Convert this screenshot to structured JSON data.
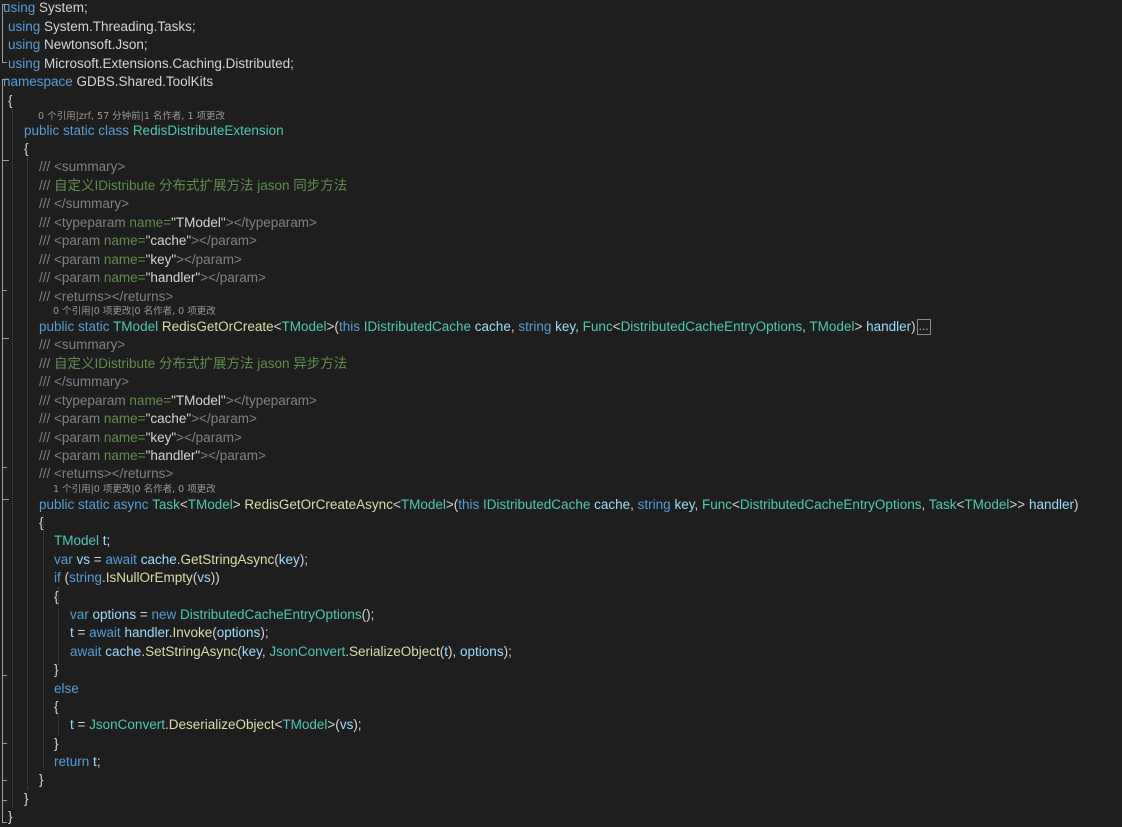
{
  "code_lines": [
    [
      {
        "c": "kw",
        "t": "using"
      },
      {
        "c": "tx",
        "t": " System;"
      }
    ],
    [
      {
        "c": "kw",
        "t": "using"
      },
      {
        "c": "tx",
        "t": " System.Threading.Tasks;"
      }
    ],
    [
      {
        "c": "kw",
        "t": "using"
      },
      {
        "c": "tx",
        "t": " Newtonsoft.Json;"
      }
    ],
    [
      {
        "c": "kw",
        "t": "using"
      },
      {
        "c": "tx",
        "t": " Microsoft.Extensions.Caching.Distributed;"
      }
    ],
    [
      {
        "c": "kw",
        "t": "namespace"
      },
      {
        "c": "tx",
        "t": " GDBS.Shared.ToolKits"
      }
    ],
    [
      {
        "c": "tx",
        "t": "{"
      }
    ],
    [
      {
        "c": "kw",
        "t": "public static class"
      },
      {
        "c": "tx",
        "t": " "
      },
      {
        "c": "ty",
        "t": "RedisDistributeExtension"
      }
    ],
    [
      {
        "c": "tx",
        "t": "{"
      }
    ],
    [
      {
        "c": "cx",
        "t": "/// <summary>"
      }
    ],
    [
      {
        "c": "cx",
        "t": "/// "
      },
      {
        "c": "cg",
        "t": "自定义IDistribute 分布式扩展方法 jason 同步方法"
      }
    ],
    [
      {
        "c": "cx",
        "t": "/// </summary>"
      }
    ],
    [
      {
        "c": "cx",
        "t": "/// <typeparam "
      },
      {
        "c": "cg",
        "t": "name="
      },
      {
        "c": "st",
        "t": "\"TModel\""
      },
      {
        "c": "cx",
        "t": "></typeparam>"
      }
    ],
    [
      {
        "c": "cx",
        "t": "/// <param "
      },
      {
        "c": "cg",
        "t": "name="
      },
      {
        "c": "st",
        "t": "\"cache\""
      },
      {
        "c": "cx",
        "t": "></param>"
      }
    ],
    [
      {
        "c": "cx",
        "t": "/// <param "
      },
      {
        "c": "cg",
        "t": "name="
      },
      {
        "c": "st",
        "t": "\"key\""
      },
      {
        "c": "cx",
        "t": "></param>"
      }
    ],
    [
      {
        "c": "cx",
        "t": "/// <param "
      },
      {
        "c": "cg",
        "t": "name="
      },
      {
        "c": "st",
        "t": "\"handler\""
      },
      {
        "c": "cx",
        "t": "></param>"
      }
    ],
    [
      {
        "c": "cx",
        "t": "/// <returns></returns>"
      }
    ],
    [
      {
        "c": "kw",
        "t": "public static"
      },
      {
        "c": "tx",
        "t": " "
      },
      {
        "c": "ty",
        "t": "TModel"
      },
      {
        "c": "tx",
        "t": " "
      },
      {
        "c": "mt",
        "t": "RedisGetOrCreate"
      },
      {
        "c": "tx",
        "t": "<"
      },
      {
        "c": "ty",
        "t": "TModel"
      },
      {
        "c": "tx",
        "t": ">("
      },
      {
        "c": "kw",
        "t": "this"
      },
      {
        "c": "tx",
        "t": " "
      },
      {
        "c": "ty",
        "t": "IDistributedCache"
      },
      {
        "c": "tx",
        "t": " "
      },
      {
        "c": "pm",
        "t": "cache"
      },
      {
        "c": "tx",
        "t": ", "
      },
      {
        "c": "kw",
        "t": "string"
      },
      {
        "c": "tx",
        "t": " "
      },
      {
        "c": "pm",
        "t": "key"
      },
      {
        "c": "tx",
        "t": ", "
      },
      {
        "c": "ty",
        "t": "Func"
      },
      {
        "c": "tx",
        "t": "<"
      },
      {
        "c": "ty",
        "t": "DistributedCacheEntryOptions"
      },
      {
        "c": "tx",
        "t": ", "
      },
      {
        "c": "ty",
        "t": "TModel"
      },
      {
        "c": "tx",
        "t": "> "
      },
      {
        "c": "pm",
        "t": "handler"
      },
      {
        "c": "tx",
        "t": ")"
      },
      {
        "c": "coll",
        "t": "..."
      }
    ],
    [
      {
        "c": "cx",
        "t": "/// <summary>"
      }
    ],
    [
      {
        "c": "cx",
        "t": "/// "
      },
      {
        "c": "cg",
        "t": "自定义IDistribute 分布式扩展方法 jason 异步方法"
      }
    ],
    [
      {
        "c": "cx",
        "t": "/// </summary>"
      }
    ],
    [
      {
        "c": "cx",
        "t": "/// <typeparam "
      },
      {
        "c": "cg",
        "t": "name="
      },
      {
        "c": "st",
        "t": "\"TModel\""
      },
      {
        "c": "cx",
        "t": "></typeparam>"
      }
    ],
    [
      {
        "c": "cx",
        "t": "/// <param "
      },
      {
        "c": "cg",
        "t": "name="
      },
      {
        "c": "st",
        "t": "\"cache\""
      },
      {
        "c": "cx",
        "t": "></param>"
      }
    ],
    [
      {
        "c": "cx",
        "t": "/// <param "
      },
      {
        "c": "cg",
        "t": "name="
      },
      {
        "c": "st",
        "t": "\"key\""
      },
      {
        "c": "cx",
        "t": "></param>"
      }
    ],
    [
      {
        "c": "cx",
        "t": "/// <param "
      },
      {
        "c": "cg",
        "t": "name="
      },
      {
        "c": "st",
        "t": "\"handler\""
      },
      {
        "c": "cx",
        "t": "></param>"
      }
    ],
    [
      {
        "c": "cx",
        "t": "/// <returns></returns>"
      }
    ],
    [
      {
        "c": "kw",
        "t": "public static async"
      },
      {
        "c": "tx",
        "t": " "
      },
      {
        "c": "ty",
        "t": "Task"
      },
      {
        "c": "tx",
        "t": "<"
      },
      {
        "c": "ty",
        "t": "TModel"
      },
      {
        "c": "tx",
        "t": "> "
      },
      {
        "c": "mt",
        "t": "RedisGetOrCreateAsync"
      },
      {
        "c": "tx",
        "t": "<"
      },
      {
        "c": "ty",
        "t": "TModel"
      },
      {
        "c": "tx",
        "t": ">("
      },
      {
        "c": "kw",
        "t": "this"
      },
      {
        "c": "tx",
        "t": " "
      },
      {
        "c": "ty",
        "t": "IDistributedCache"
      },
      {
        "c": "tx",
        "t": " "
      },
      {
        "c": "pm",
        "t": "cache"
      },
      {
        "c": "tx",
        "t": ", "
      },
      {
        "c": "kw",
        "t": "string"
      },
      {
        "c": "tx",
        "t": " "
      },
      {
        "c": "pm",
        "t": "key"
      },
      {
        "c": "tx",
        "t": ", "
      },
      {
        "c": "ty",
        "t": "Func"
      },
      {
        "c": "tx",
        "t": "<"
      },
      {
        "c": "ty",
        "t": "DistributedCacheEntryOptions"
      },
      {
        "c": "tx",
        "t": ", "
      },
      {
        "c": "ty",
        "t": "Task"
      },
      {
        "c": "tx",
        "t": "<"
      },
      {
        "c": "ty",
        "t": "TModel"
      },
      {
        "c": "tx",
        "t": ">> "
      },
      {
        "c": "pm",
        "t": "handler"
      },
      {
        "c": "tx",
        "t": ")"
      }
    ],
    [
      {
        "c": "tx",
        "t": "{"
      }
    ],
    [
      {
        "c": "ty",
        "t": "TModel"
      },
      {
        "c": "tx",
        "t": " "
      },
      {
        "c": "pm",
        "t": "t"
      },
      {
        "c": "tx",
        "t": ";"
      }
    ],
    [
      {
        "c": "kw",
        "t": "var"
      },
      {
        "c": "tx",
        "t": " "
      },
      {
        "c": "pm",
        "t": "vs"
      },
      {
        "c": "tx",
        "t": " = "
      },
      {
        "c": "kw",
        "t": "await"
      },
      {
        "c": "tx",
        "t": " "
      },
      {
        "c": "pm",
        "t": "cache"
      },
      {
        "c": "tx",
        "t": "."
      },
      {
        "c": "mt",
        "t": "GetStringAsync"
      },
      {
        "c": "tx",
        "t": "("
      },
      {
        "c": "pm",
        "t": "key"
      },
      {
        "c": "tx",
        "t": ");"
      }
    ],
    [
      {
        "c": "kw",
        "t": "if"
      },
      {
        "c": "tx",
        "t": " ("
      },
      {
        "c": "kw",
        "t": "string"
      },
      {
        "c": "tx",
        "t": "."
      },
      {
        "c": "mt",
        "t": "IsNullOrEmpty"
      },
      {
        "c": "tx",
        "t": "("
      },
      {
        "c": "pm",
        "t": "vs"
      },
      {
        "c": "tx",
        "t": "))"
      }
    ],
    [
      {
        "c": "tx",
        "t": "{"
      }
    ],
    [
      {
        "c": "kw",
        "t": "var"
      },
      {
        "c": "tx",
        "t": " "
      },
      {
        "c": "pm",
        "t": "options"
      },
      {
        "c": "tx",
        "t": " = "
      },
      {
        "c": "kw",
        "t": "new"
      },
      {
        "c": "tx",
        "t": " "
      },
      {
        "c": "ty",
        "t": "DistributedCacheEntryOptions"
      },
      {
        "c": "tx",
        "t": "();"
      }
    ],
    [
      {
        "c": "pm",
        "t": "t"
      },
      {
        "c": "tx",
        "t": " = "
      },
      {
        "c": "kw",
        "t": "await"
      },
      {
        "c": "tx",
        "t": " "
      },
      {
        "c": "pm",
        "t": "handler"
      },
      {
        "c": "tx",
        "t": "."
      },
      {
        "c": "mt",
        "t": "Invoke"
      },
      {
        "c": "tx",
        "t": "("
      },
      {
        "c": "pm",
        "t": "options"
      },
      {
        "c": "tx",
        "t": ");"
      }
    ],
    [
      {
        "c": "kw",
        "t": "await"
      },
      {
        "c": "tx",
        "t": " "
      },
      {
        "c": "pm",
        "t": "cache"
      },
      {
        "c": "tx",
        "t": "."
      },
      {
        "c": "mt",
        "t": "SetStringAsync"
      },
      {
        "c": "tx",
        "t": "("
      },
      {
        "c": "pm",
        "t": "key"
      },
      {
        "c": "tx",
        "t": ", "
      },
      {
        "c": "ty",
        "t": "JsonConvert"
      },
      {
        "c": "tx",
        "t": "."
      },
      {
        "c": "mt",
        "t": "SerializeObject"
      },
      {
        "c": "tx",
        "t": "("
      },
      {
        "c": "pm",
        "t": "t"
      },
      {
        "c": "tx",
        "t": "), "
      },
      {
        "c": "pm",
        "t": "options"
      },
      {
        "c": "tx",
        "t": ");"
      }
    ],
    [
      {
        "c": "tx",
        "t": "}"
      }
    ],
    [
      {
        "c": "kw",
        "t": "else"
      }
    ],
    [
      {
        "c": "tx",
        "t": "{"
      }
    ],
    [
      {
        "c": "pm",
        "t": "t"
      },
      {
        "c": "tx",
        "t": " = "
      },
      {
        "c": "ty",
        "t": "JsonConvert"
      },
      {
        "c": "tx",
        "t": "."
      },
      {
        "c": "mt",
        "t": "DeserializeObject"
      },
      {
        "c": "tx",
        "t": "<"
      },
      {
        "c": "ty",
        "t": "TModel"
      },
      {
        "c": "tx",
        "t": ">("
      },
      {
        "c": "pm",
        "t": "vs"
      },
      {
        "c": "tx",
        "t": ");"
      }
    ],
    [
      {
        "c": "tx",
        "t": "}"
      }
    ],
    [
      {
        "c": "kw",
        "t": "return"
      },
      {
        "c": "tx",
        "t": " "
      },
      {
        "c": "pm",
        "t": "t"
      },
      {
        "c": "tx",
        "t": ";"
      }
    ],
    [
      {
        "c": "tx",
        "t": "}"
      }
    ],
    [
      {
        "c": "tx",
        "t": "}"
      }
    ],
    [
      {
        "c": "tx",
        "t": "}"
      }
    ]
  ],
  "codelens": {
    "class": "0 个引用|zrf, 57 分钟前|1 名作者, 1 项更改",
    "sync_method": "0 个引用|0 项更改|0 名作者, 0 项更改",
    "async_method": "1 个引用|0 项更改|0 名作者, 0 项更改"
  }
}
